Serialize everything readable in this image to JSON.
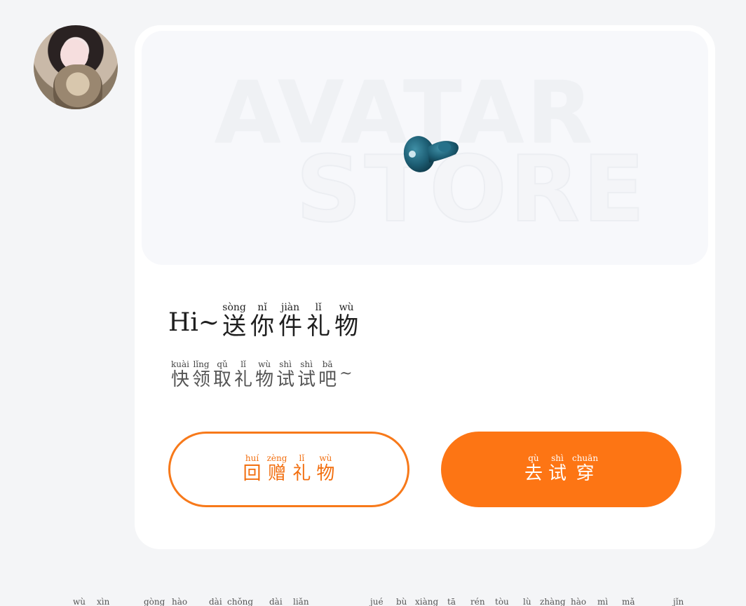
{
  "banner": {
    "word1": "AVATAR",
    "word2": "STORE"
  },
  "greeting": {
    "hi": "Hi~",
    "title": [
      {
        "char": "送",
        "pinyin": "sòng"
      },
      {
        "char": "你",
        "pinyin": "nǐ"
      },
      {
        "char": "件",
        "pinyin": "jiàn"
      },
      {
        "char": "礼",
        "pinyin": "lǐ"
      },
      {
        "char": "物",
        "pinyin": "wù"
      }
    ],
    "subtitle": [
      {
        "char": "快",
        "pinyin": "kuài"
      },
      {
        "char": "领",
        "pinyin": "lǐng"
      },
      {
        "char": "取",
        "pinyin": "qǔ"
      },
      {
        "char": "礼",
        "pinyin": "lǐ"
      },
      {
        "char": "物",
        "pinyin": "wù"
      },
      {
        "char": "试",
        "pinyin": "shì"
      },
      {
        "char": "试",
        "pinyin": "shì"
      },
      {
        "char": "吧",
        "pinyin": "bā"
      }
    ],
    "subtitle_tail": "~"
  },
  "buttons": {
    "return_gift": [
      {
        "char": "回",
        "pinyin": "huí"
      },
      {
        "char": "赠",
        "pinyin": "zèng"
      },
      {
        "char": "礼",
        "pinyin": "lǐ"
      },
      {
        "char": "物",
        "pinyin": "wù"
      }
    ],
    "try_on": [
      {
        "char": "去",
        "pinyin": "qù"
      },
      {
        "char": "试",
        "pinyin": "shì"
      },
      {
        "char": "穿",
        "pinyin": "chuān"
      }
    ]
  },
  "footer_pinyin": [
    "wù",
    "xìn",
    "gòng",
    "hào",
    "dài",
    "chǒng",
    "dài",
    "liǎn",
    "jué",
    "bù",
    "xiàng",
    "tā",
    "rén",
    "tòu",
    "lù",
    "zhàng",
    "hào",
    "mì",
    "mǎ",
    "jǐn"
  ],
  "colors": {
    "accent": "#fd7514",
    "background": "#f4f5f7",
    "card": "#ffffff"
  }
}
